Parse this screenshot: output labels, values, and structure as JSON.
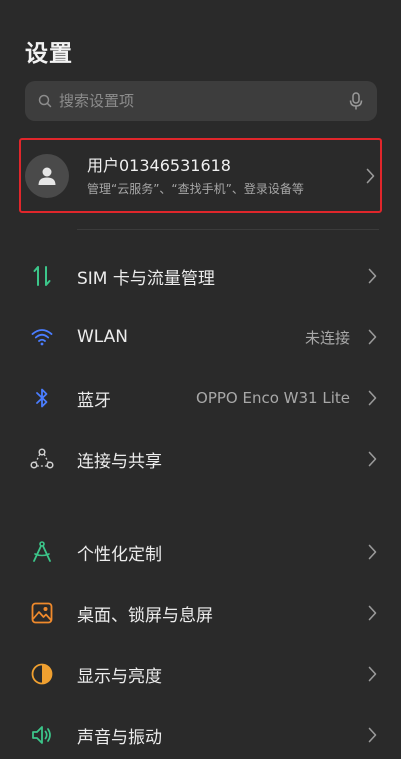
{
  "header": {
    "title": "设置"
  },
  "search": {
    "placeholder": "搜索设置项"
  },
  "account": {
    "name": "用户01346531618",
    "subtitle": "管理“云服务”、“查找手机”、登录设备等"
  },
  "sections": [
    {
      "items": [
        {
          "label": "SIM 卡与流量管理",
          "value": "",
          "icon": "sim-data-icon"
        },
        {
          "label": "WLAN",
          "value": "未连接",
          "icon": "wifi-icon"
        },
        {
          "label": "蓝牙",
          "value": "OPPO Enco W31 Lite",
          "icon": "bluetooth-icon"
        },
        {
          "label": "连接与共享",
          "value": "",
          "icon": "connection-share-icon"
        }
      ]
    },
    {
      "items": [
        {
          "label": "个性化定制",
          "value": "",
          "icon": "personalize-icon"
        },
        {
          "label": "桌面、锁屏与息屏",
          "value": "",
          "icon": "wallpaper-icon"
        },
        {
          "label": "显示与亮度",
          "value": "",
          "icon": "display-brightness-icon"
        },
        {
          "label": "声音与振动",
          "value": "",
          "icon": "sound-vibration-icon"
        }
      ]
    }
  ],
  "colors": {
    "background": "#2a2a2a",
    "search_bg": "#3d3d3d",
    "highlight_border": "#e0262b",
    "sim_icon": "#3cc68a",
    "wifi_icon": "#4a7dff",
    "bluetooth_icon": "#4a7dff",
    "connection_icon": "#d0d0d0",
    "personalize_icon": "#3cc68a",
    "wallpaper_icon": "#f08a2c",
    "display_icon": "#f0a030",
    "sound_icon": "#3cc68a"
  }
}
